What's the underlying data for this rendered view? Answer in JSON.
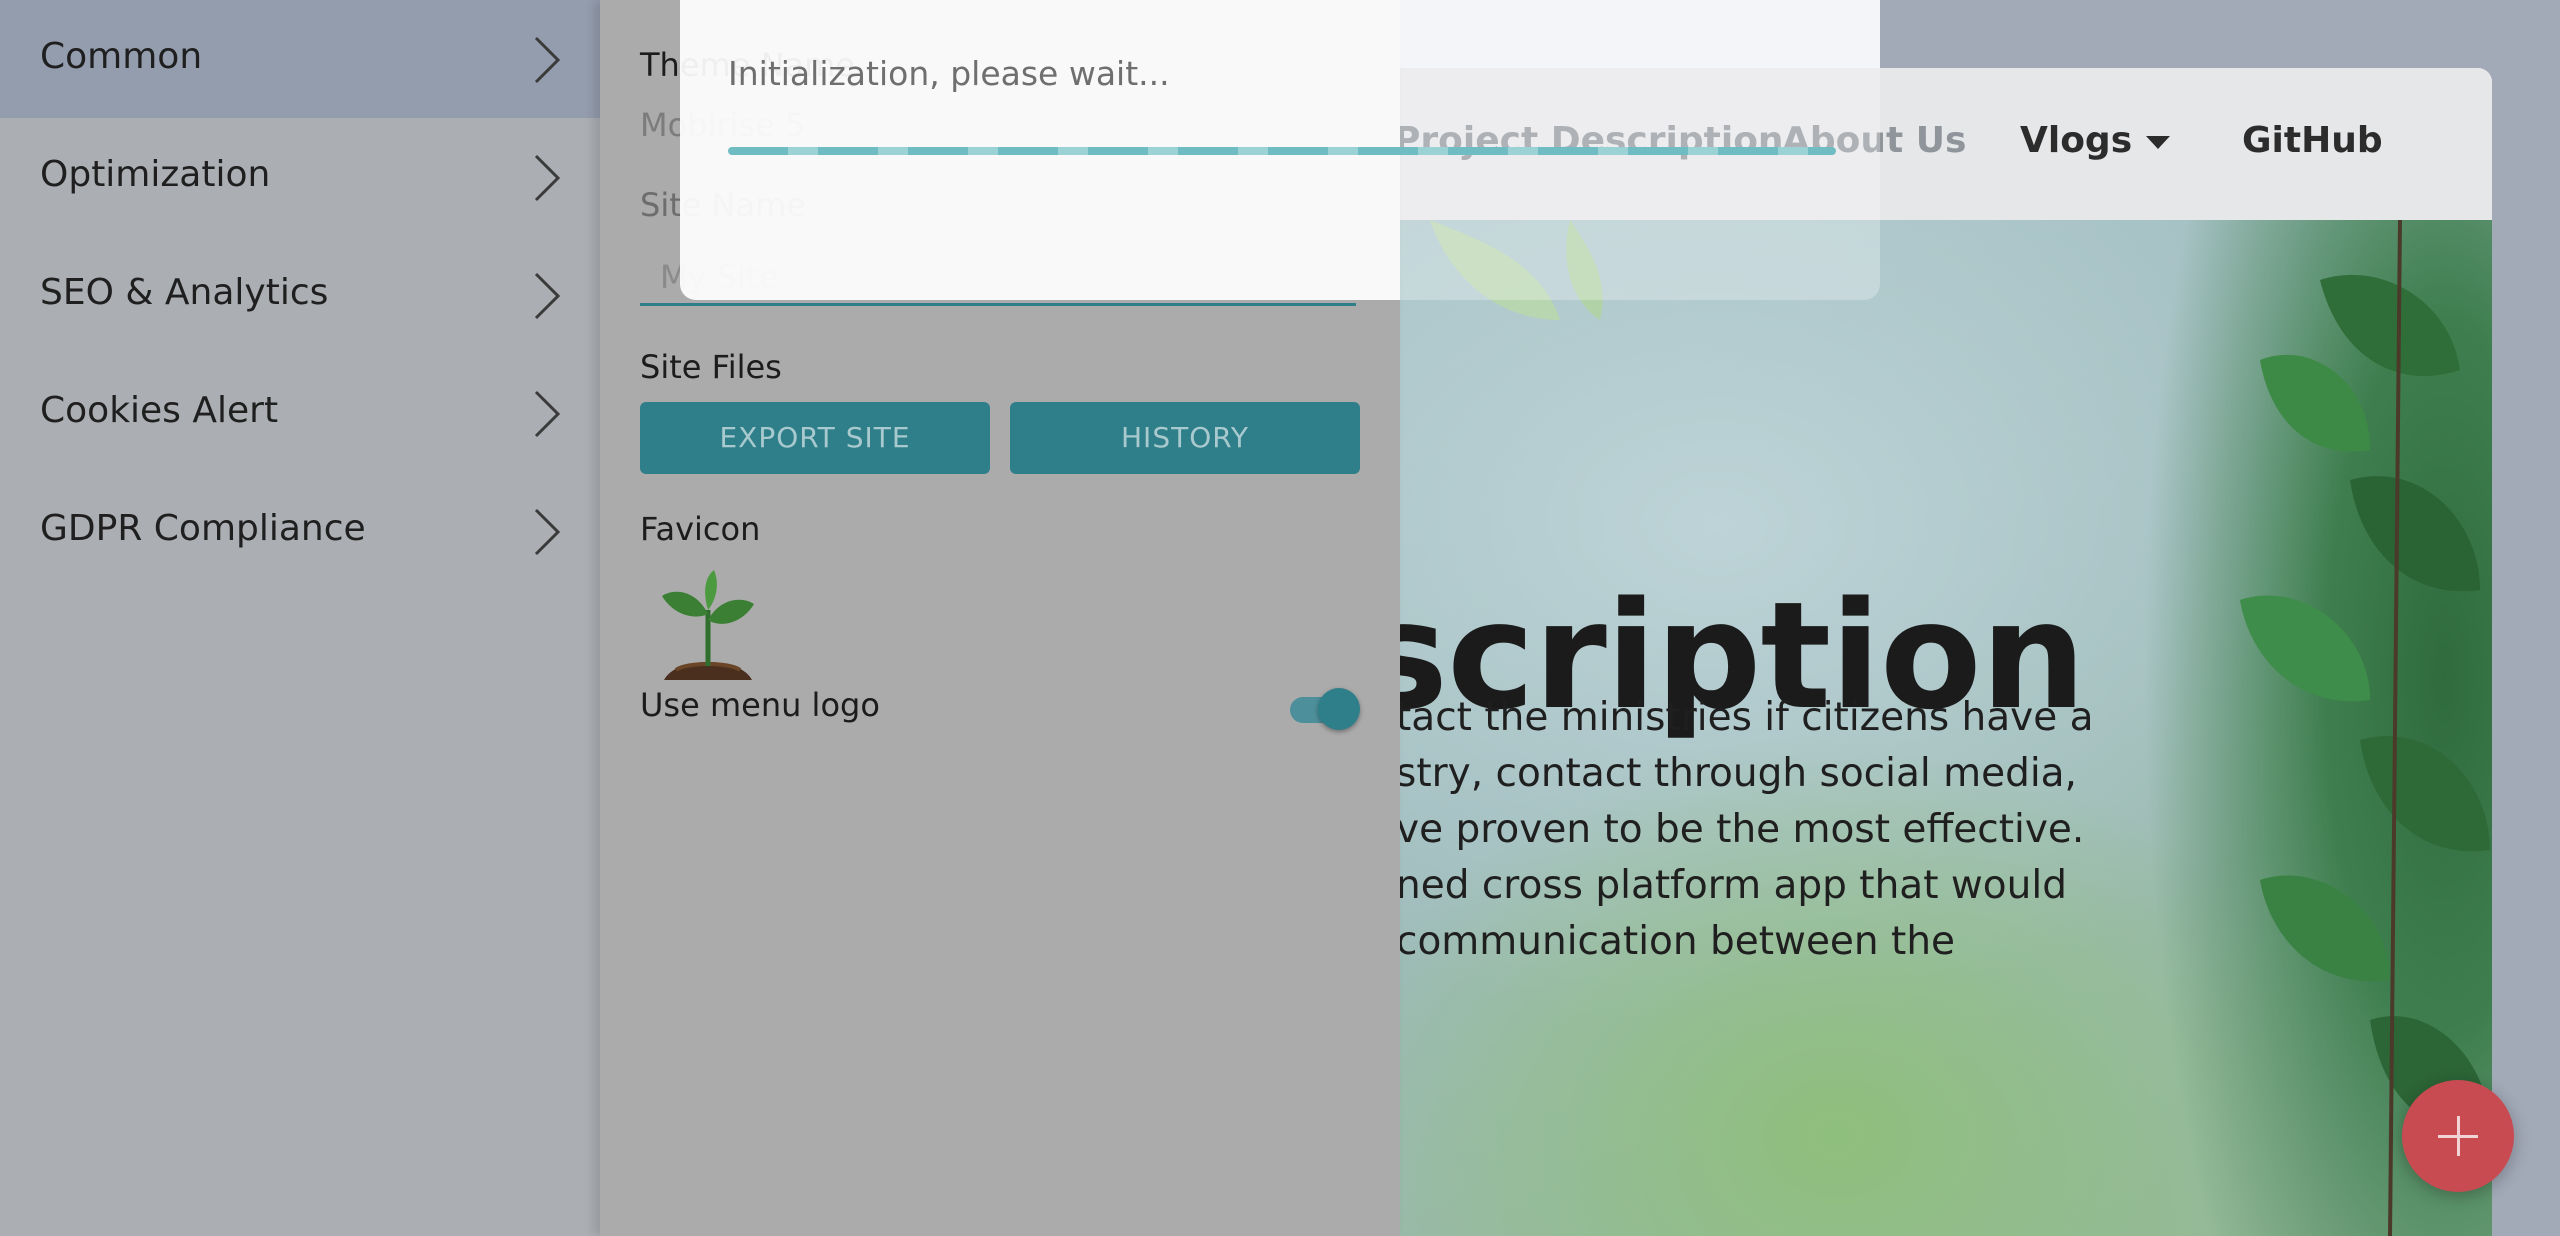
{
  "site": {
    "nav": {
      "project_description": "Project Description",
      "about_us": "About Us",
      "vlogs": "Vlogs",
      "github": "GitHub"
    },
    "hero": {
      "title": "scription",
      "lines": [
        "tact the ministries if citizens have a",
        "stry, contact through social media,",
        "ve proven to be the most effective.",
        "ned cross platform app that would",
        "communication between the"
      ]
    },
    "fab_icon": "plus-icon"
  },
  "menu": {
    "items": [
      {
        "label": "Common",
        "active": true
      },
      {
        "label": "Optimization",
        "active": false
      },
      {
        "label": "SEO & Analytics",
        "active": false
      },
      {
        "label": "Cookies Alert",
        "active": false
      },
      {
        "label": "GDPR Compliance",
        "active": false
      }
    ]
  },
  "panel": {
    "theme_name_label": "Theme Name",
    "theme_name_value": "Mobirise 5",
    "site_name_label": "Site Name",
    "site_name_placeholder": "My Site",
    "site_files_label": "Site Files",
    "export_button": "EXPORT SITE",
    "history_button": "HISTORY",
    "favicon_label": "Favicon",
    "use_menu_logo_label": "Use menu logo",
    "use_menu_logo_on": true
  },
  "dialog": {
    "message": "Initialization, please wait..."
  },
  "colors": {
    "accent": "#2f7f8a",
    "fab": "#c94b52",
    "active_menu": "#949dae"
  }
}
